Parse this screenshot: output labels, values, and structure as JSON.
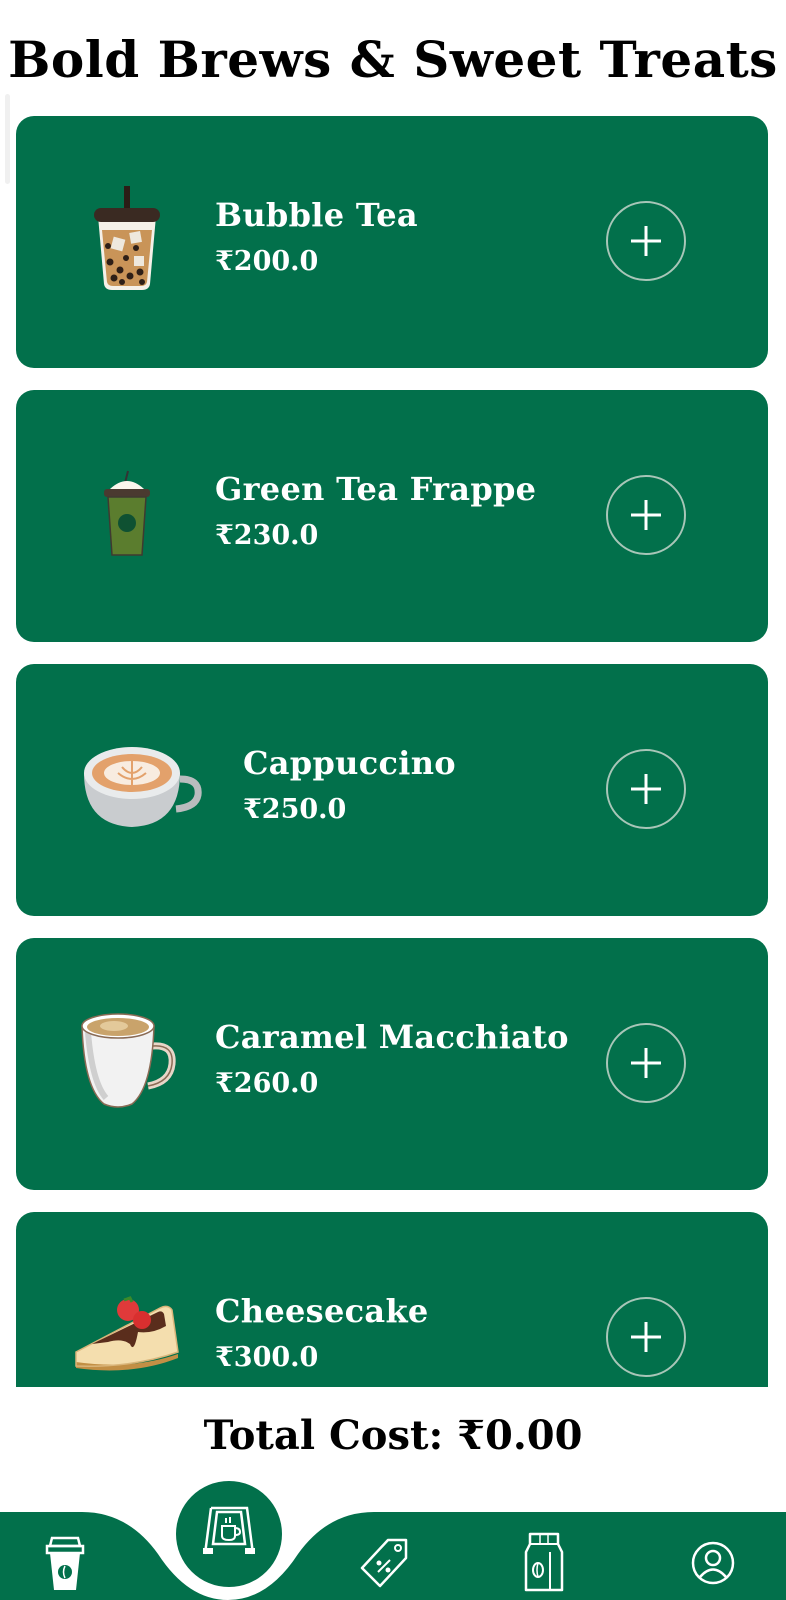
{
  "header": {
    "title": "Bold Brews & Sweet Treats"
  },
  "menu": {
    "items": [
      {
        "name": "Bubble Tea",
        "price": "₹200.0",
        "image_icon": "bubble-tea-icon"
      },
      {
        "name": "Green Tea Frappe",
        "price": "₹230.0",
        "image_icon": "green-tea-frappe-icon"
      },
      {
        "name": "Cappuccino",
        "price": "₹250.0",
        "image_icon": "cappuccino-cup-icon"
      },
      {
        "name": "Caramel Macchiato",
        "price": "₹260.0",
        "image_icon": "macchiato-mug-icon"
      },
      {
        "name": "Cheesecake",
        "price": "₹300.0",
        "image_icon": "cheesecake-slice-icon"
      }
    ],
    "add_icon": "plus-icon"
  },
  "footer": {
    "total_label": "Total Cost: ₹0.00"
  },
  "bottom_nav": {
    "items": [
      {
        "icon": "coffee-cup-icon",
        "active": false
      },
      {
        "icon": "menu-board-icon",
        "active": true
      },
      {
        "icon": "discount-tag-icon",
        "active": false
      },
      {
        "icon": "coffee-bag-icon",
        "active": false
      },
      {
        "icon": "profile-icon",
        "active": false
      }
    ]
  },
  "colors": {
    "brand_green": "#02704b",
    "background": "#ffffff",
    "text": "#000000"
  }
}
